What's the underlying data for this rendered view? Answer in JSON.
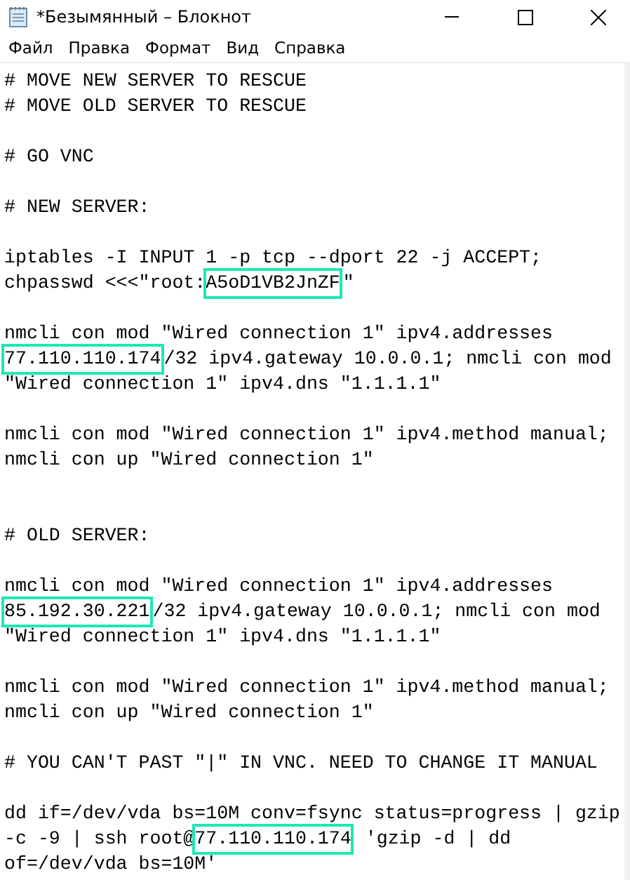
{
  "window": {
    "title": "*Безымянный – Блокнот"
  },
  "menu": [
    "Файл",
    "Правка",
    "Формат",
    "Вид",
    "Справка"
  ],
  "editor": {
    "lines": [
      {
        "kind": "text",
        "segments": [
          {
            "text": "# MOVE NEW SERVER TO RESCUE",
            "highlighted": false
          }
        ]
      },
      {
        "kind": "text",
        "segments": [
          {
            "text": "# MOVE OLD SERVER TO RESCUE",
            "highlighted": false
          }
        ]
      },
      {
        "kind": "blank"
      },
      {
        "kind": "text",
        "segments": [
          {
            "text": "# GO VNC",
            "highlighted": false
          }
        ]
      },
      {
        "kind": "blank"
      },
      {
        "kind": "text",
        "segments": [
          {
            "text": "# NEW SERVER:",
            "highlighted": false
          }
        ]
      },
      {
        "kind": "blank"
      },
      {
        "kind": "text",
        "segments": [
          {
            "text": "iptables -I INPUT 1 -p tcp --dport 22 -j ACCEPT;",
            "highlighted": false
          }
        ]
      },
      {
        "kind": "text",
        "segments": [
          {
            "text": "chpasswd <<<\"root:",
            "highlighted": false
          },
          {
            "text": "A5oD1VB2JnZF",
            "highlighted": true
          },
          {
            "text": "\"",
            "highlighted": false
          }
        ]
      },
      {
        "kind": "blank"
      },
      {
        "kind": "text",
        "segments": [
          {
            "text": "nmcli con mod \"Wired connection 1\" ipv4.addresses",
            "highlighted": false
          }
        ]
      },
      {
        "kind": "text",
        "segments": [
          {
            "text": "77.110.110.174",
            "highlighted": true
          },
          {
            "text": "/32 ipv4.gateway 10.0.0.1; nmcli con mod",
            "highlighted": false
          }
        ]
      },
      {
        "kind": "text",
        "segments": [
          {
            "text": "\"Wired connection 1\" ipv4.dns \"1.1.1.1\"",
            "highlighted": false
          }
        ]
      },
      {
        "kind": "blank"
      },
      {
        "kind": "text",
        "segments": [
          {
            "text": "nmcli con mod \"Wired connection 1\" ipv4.method manual;",
            "highlighted": false
          }
        ]
      },
      {
        "kind": "text",
        "segments": [
          {
            "text": "nmcli con up \"Wired connection 1\"",
            "highlighted": false
          }
        ]
      },
      {
        "kind": "blank"
      },
      {
        "kind": "blank"
      },
      {
        "kind": "text",
        "segments": [
          {
            "text": "# OLD SERVER:",
            "highlighted": false
          }
        ]
      },
      {
        "kind": "blank"
      },
      {
        "kind": "text",
        "segments": [
          {
            "text": "nmcli con mod \"Wired connection 1\" ipv4.addresses",
            "highlighted": false
          }
        ]
      },
      {
        "kind": "text",
        "segments": [
          {
            "text": "85.192.30.221",
            "highlighted": true
          },
          {
            "text": "/32 ipv4.gateway 10.0.0.1; nmcli con mod",
            "highlighted": false
          }
        ]
      },
      {
        "kind": "text",
        "segments": [
          {
            "text": "\"Wired connection 1\" ipv4.dns \"1.1.1.1\"",
            "highlighted": false
          }
        ]
      },
      {
        "kind": "blank"
      },
      {
        "kind": "text",
        "segments": [
          {
            "text": "nmcli con mod \"Wired connection 1\" ipv4.method manual;",
            "highlighted": false
          }
        ]
      },
      {
        "kind": "text",
        "segments": [
          {
            "text": "nmcli con up \"Wired connection 1\"",
            "highlighted": false
          }
        ]
      },
      {
        "kind": "blank"
      },
      {
        "kind": "text",
        "segments": [
          {
            "text": "# YOU CAN'T PAST \"|\" IN VNC. NEED TO CHANGE IT MANUAL",
            "highlighted": false
          }
        ]
      },
      {
        "kind": "blank"
      },
      {
        "kind": "text",
        "segments": [
          {
            "text": "dd if=/dev/vda bs=10M conv=fsync status=progress | gzip",
            "highlighted": false
          }
        ]
      },
      {
        "kind": "text",
        "segments": [
          {
            "text": "-c -9 | ssh root@",
            "highlighted": false
          },
          {
            "text": "77.110.110.174",
            "highlighted": true
          },
          {
            "text": " 'gzip -d | dd",
            "highlighted": false
          }
        ]
      },
      {
        "kind": "text",
        "segments": [
          {
            "text": "of=/dev/vda bs=10M'",
            "highlighted": false
          }
        ]
      }
    ]
  }
}
